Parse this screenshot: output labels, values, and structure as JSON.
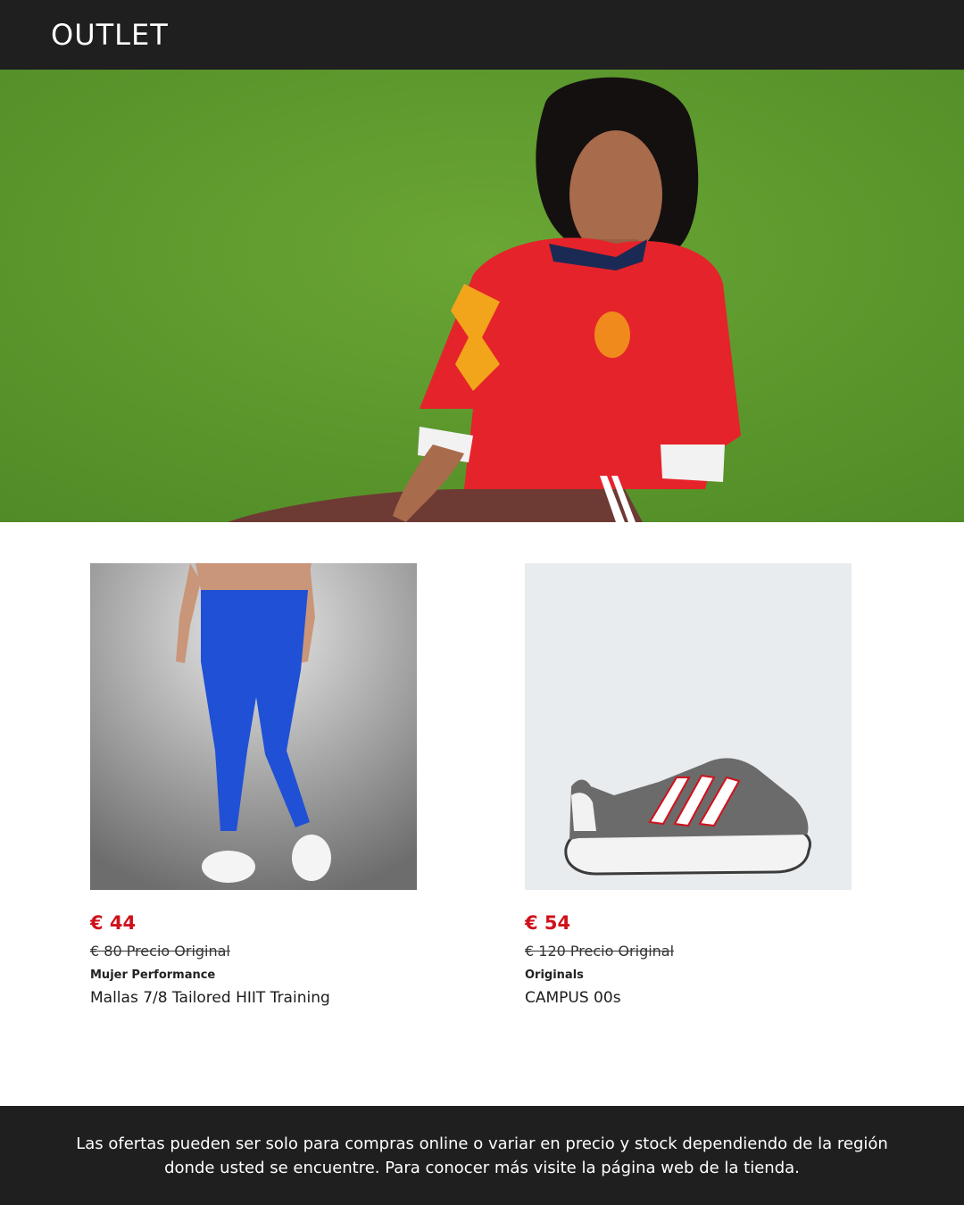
{
  "header": {
    "brand": "OUTLET"
  },
  "hero": {
    "image": "woman-in-red-adidas-jersey-on-green-wall",
    "colors": {
      "wall": "#5f9c2e",
      "jersey": "#e5232a"
    }
  },
  "products": [
    {
      "image": "blue-leggings",
      "price": "€ 44",
      "original_price": "€ 80 Precio Original",
      "category": "Mujer Performance",
      "name": "Mallas 7/8 Tailored HIIT Training"
    },
    {
      "image": "grey-campus-sneaker",
      "price": "€ 54",
      "original_price": "€ 120 Precio Original",
      "category": "Originals",
      "name": "CAMPUS 00s"
    }
  ],
  "footer": {
    "disclaimer": "Las ofertas pueden ser solo para compras online o variar en precio y stock dependiendo de la región donde usted se encuentre. Para conocer más visite la página web de la tienda."
  },
  "colors": {
    "bar": "#1f1f1f",
    "price_red": "#d0111b"
  }
}
